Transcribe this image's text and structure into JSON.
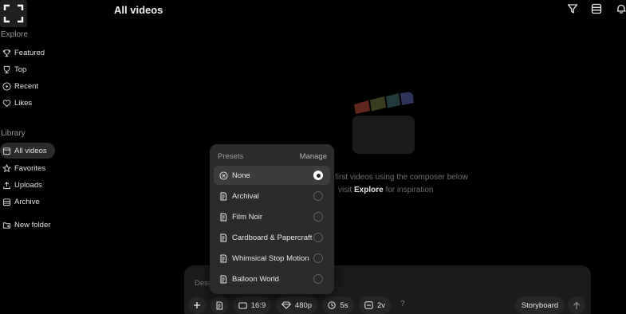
{
  "page": {
    "title": "All videos"
  },
  "sidebar": {
    "explore_label": "Explore",
    "library_label": "Library",
    "explore_items": [
      {
        "label": "Featured",
        "icon": "trophy-icon"
      },
      {
        "label": "Top",
        "icon": "cup-icon"
      },
      {
        "label": "Recent",
        "icon": "play-circle-icon"
      },
      {
        "label": "Likes",
        "icon": "heart-icon"
      }
    ],
    "library_items": [
      {
        "label": "All videos",
        "icon": "calendar-icon",
        "active": true
      },
      {
        "label": "Favorites",
        "icon": "star-icon"
      },
      {
        "label": "Uploads",
        "icon": "upload-icon"
      },
      {
        "label": "Archive",
        "icon": "archive-icon"
      }
    ],
    "new_folder_label": "New folder"
  },
  "empty_state": {
    "line1": "first videos using the composer below",
    "line2_before": "visit ",
    "line2_link": "Explore",
    "line2_after": " for inspiration"
  },
  "presets": {
    "header": "Presets",
    "manage": "Manage",
    "items": [
      {
        "label": "None",
        "icon": "x-circle-icon",
        "selected": true
      },
      {
        "label": "Archival",
        "icon": "preset-icon",
        "selected": false
      },
      {
        "label": "Film Noir",
        "icon": "preset-icon",
        "selected": false
      },
      {
        "label": "Cardboard & Papercraft",
        "icon": "preset-icon",
        "selected": false
      },
      {
        "label": "Whimsical Stop Motion",
        "icon": "preset-icon",
        "selected": false
      },
      {
        "label": "Balloon World",
        "icon": "preset-icon",
        "selected": false
      }
    ]
  },
  "composer": {
    "placeholder_visible": "Desc",
    "aspect_ratio": "16:9",
    "resolution": "480p",
    "duration": "5s",
    "variations": "2v",
    "help": "?",
    "storyboard": "Storyboard"
  },
  "colors": {
    "background": "#000000",
    "panel": "#1b1b1b",
    "popover": "#2b2b2b",
    "selected_row": "#3c3c3c",
    "clapper_stripes": [
      "#b0483a",
      "#6b6f3a",
      "#3f6a6d",
      "#4a4f8c"
    ]
  }
}
